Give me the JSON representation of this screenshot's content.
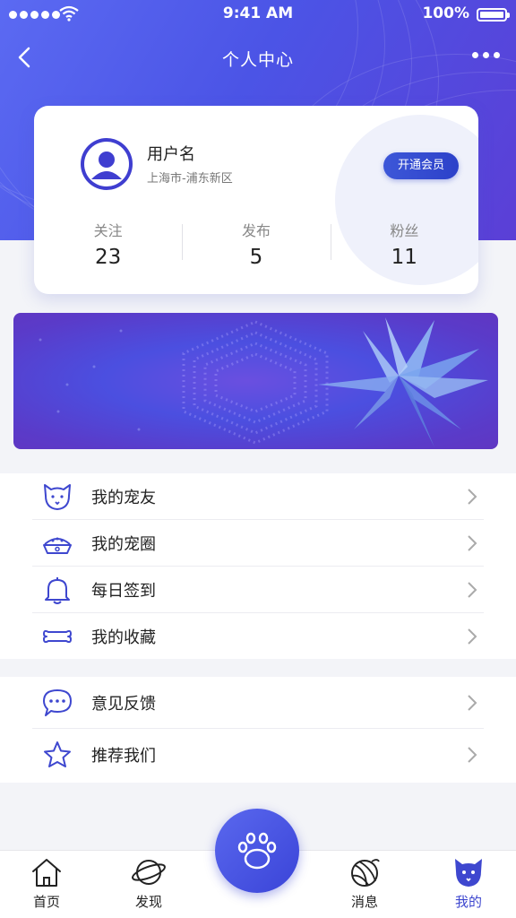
{
  "status_bar": {
    "time": "9:41 AM",
    "battery": "100%"
  },
  "nav": {
    "title": "个人中心"
  },
  "profile": {
    "username": "用户名",
    "location": "上海市-浦东新区",
    "vip_label": "开通会员",
    "stats": [
      {
        "label": "关注",
        "value": "23"
      },
      {
        "label": "发布",
        "value": "5"
      },
      {
        "label": "粉丝",
        "value": "11"
      }
    ]
  },
  "menu": {
    "group1": [
      {
        "label": "我的宠友",
        "icon": "dog-face-icon"
      },
      {
        "label": "我的宠圈",
        "icon": "pet-bowl-icon"
      },
      {
        "label": "每日签到",
        "icon": "bell-icon"
      },
      {
        "label": "我的收藏",
        "icon": "bone-icon"
      }
    ],
    "group2": [
      {
        "label": "意见反馈",
        "icon": "chat-bubble-icon"
      },
      {
        "label": "推荐我们",
        "icon": "star-icon"
      }
    ]
  },
  "tabs": [
    {
      "label": "首页",
      "icon": "home-icon"
    },
    {
      "label": "发现",
      "icon": "planet-icon"
    },
    {
      "label": "消息",
      "icon": "yarn-ball-icon"
    },
    {
      "label": "我的",
      "icon": "dog-face-icon",
      "active": true
    }
  ],
  "colors": {
    "primary": "#3e47cf",
    "hero_start": "#5b6af2",
    "hero_end": "#5b3fd6"
  }
}
